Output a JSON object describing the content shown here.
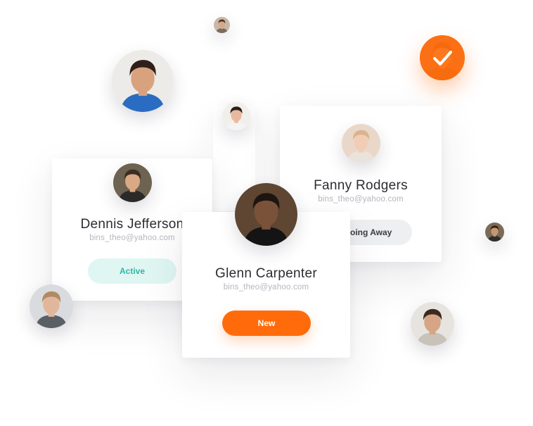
{
  "cards": {
    "fanny": {
      "name": "Fanny Rodgers",
      "email": "bins_theo@yahoo.com",
      "status_label": "Going Away",
      "status_bg": "#eeeff1",
      "status_fg": "#3b3c42"
    },
    "dennis": {
      "name": "Dennis Jefferson",
      "email": "bins_theo@yahoo.com",
      "status_label": "Active",
      "status_bg": "#dff6f3",
      "status_fg": "#2fb8a4"
    },
    "glenn": {
      "name": "Glenn Carpenter",
      "email": "bins_theo@yahoo.com",
      "status_label": "New",
      "status_bg": "#ff6b0a",
      "status_fg": "#ffffff"
    }
  },
  "colors": {
    "accent": "#ff6b0a",
    "text": "#2c2d33",
    "muted": "#b4b6bd"
  },
  "icons": {
    "selected": "checkmark-icon"
  }
}
